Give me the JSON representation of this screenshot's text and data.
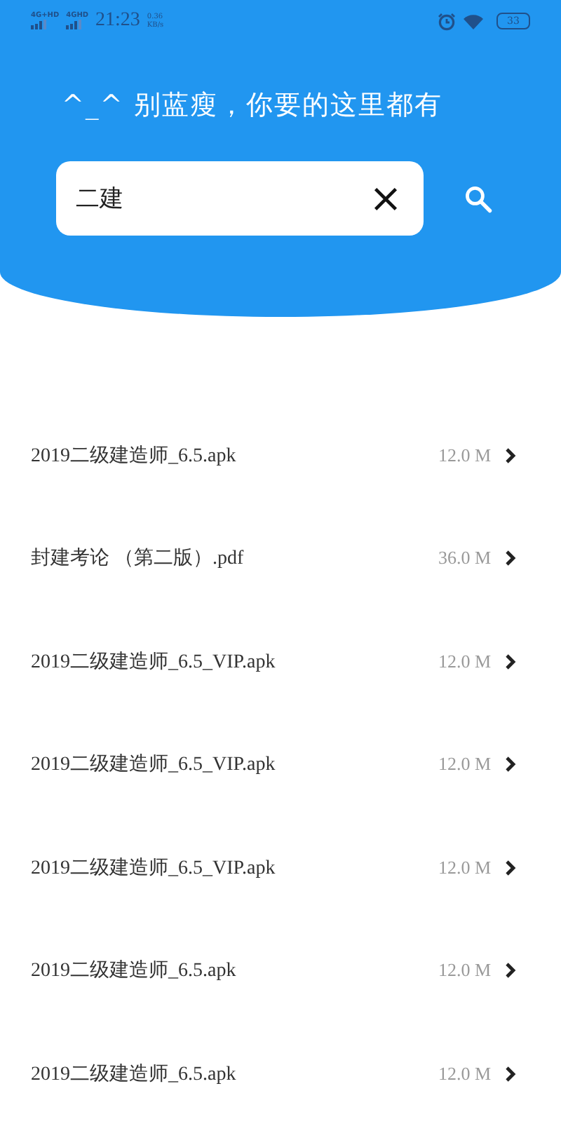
{
  "status_bar": {
    "signal_labels": [
      "4G+HD",
      "4GHD"
    ],
    "time": "21:23",
    "speed": [
      "0.36",
      "KB/s"
    ],
    "battery": "33"
  },
  "header": {
    "title": "^_^ 别蓝瘦，你要的这里都有"
  },
  "search": {
    "value": "二建"
  },
  "files": [
    {
      "name": "2019二级建造师_6.5.apk",
      "size": "12.0 M"
    },
    {
      "name": "封建考论 （第二版）.pdf",
      "size": "36.0 M"
    },
    {
      "name": "2019二级建造师_6.5_VIP.apk",
      "size": "12.0 M"
    },
    {
      "name": "2019二级建造师_6.5_VIP.apk",
      "size": "12.0 M"
    },
    {
      "name": "2019二级建造师_6.5_VIP.apk",
      "size": "12.0 M"
    },
    {
      "name": "2019二级建造师_6.5.apk",
      "size": "12.0 M"
    },
    {
      "name": "2019二级建造师_6.5.apk",
      "size": "12.0 M"
    }
  ]
}
